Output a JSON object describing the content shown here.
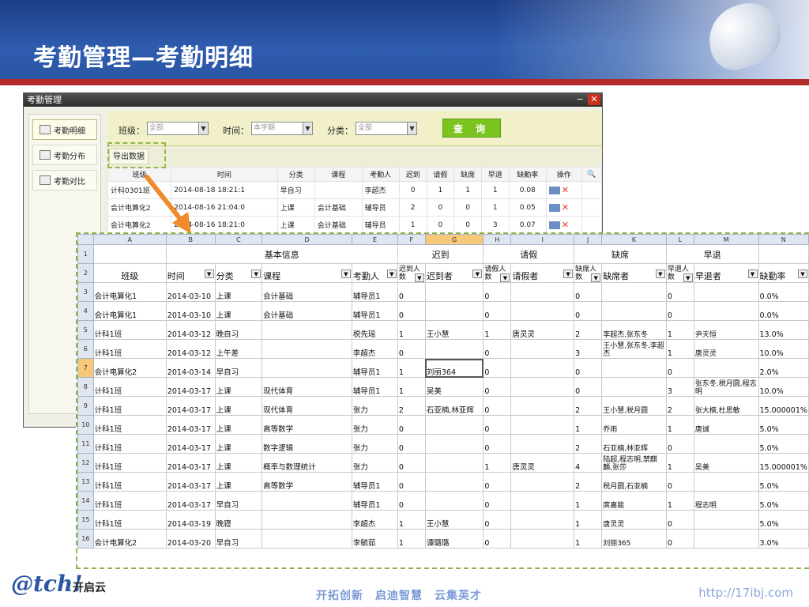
{
  "slide": {
    "title": "考勤管理—考勤明细"
  },
  "window": {
    "title": "考勤管理",
    "min": "−",
    "close": "✕",
    "sidebar": [
      "考勤明细",
      "考勤分布",
      "考勤对比"
    ],
    "filters": {
      "class_label": "班级：",
      "class_value": "全部",
      "time_label": "时间：",
      "time_value": "本学期",
      "type_label": "分类：",
      "type_value": "全部",
      "query": "查 询"
    },
    "export": "导出数据",
    "grid": {
      "headers": [
        "班级",
        "时间",
        "分类",
        "课程",
        "考勤人",
        "迟到",
        "请假",
        "缺席",
        "早退",
        "缺勤率",
        "操作"
      ],
      "rows": [
        [
          "计科0301班",
          "2014-08-18 18:21:1",
          "早自习",
          "",
          "李超杰",
          "0",
          "1",
          "1",
          "1",
          "0.08"
        ],
        [
          "会计电算化2",
          "2014-08-16 21:04:0",
          "上课",
          "会计基础",
          "辅导员",
          "2",
          "0",
          "0",
          "1",
          "0.05"
        ],
        [
          "会计电算化2",
          "2014-08-16 18:21:0",
          "上课",
          "会计基础",
          "辅导员",
          "1",
          "0",
          "0",
          "3",
          "0.07"
        ]
      ]
    }
  },
  "sheet": {
    "columns": [
      "A",
      "B",
      "C",
      "D",
      "E",
      "F",
      "G",
      "H",
      "I",
      "J",
      "K",
      "L",
      "M",
      "N"
    ],
    "groups": {
      "basic": "基本信息",
      "late": "迟到",
      "leave": "请假",
      "absent": "缺席",
      "early": "早退"
    },
    "headers": {
      "class": "班级",
      "time": "时间",
      "type": "分类",
      "course": "课程",
      "checker": "考勤人",
      "late_count": "迟到人数",
      "late_names": "迟到者",
      "leave_count": "请假人数",
      "leave_names": "请假者",
      "absent_count": "缺席人数",
      "absent_names": "缺席者",
      "early_count": "早退人数",
      "early_names": "早退者",
      "rate": "缺勤率"
    },
    "rows": [
      [
        "3",
        "会计电算化1",
        "2014-03-10",
        "上课",
        "会计基础",
        "辅导员1",
        "0",
        "",
        "0",
        "",
        "0",
        "",
        "0",
        "",
        "0.0%"
      ],
      [
        "4",
        "会计电算化1",
        "2014-03-10",
        "上课",
        "会计基础",
        "辅导员1",
        "0",
        "",
        "0",
        "",
        "0",
        "",
        "0",
        "",
        "0.0%"
      ],
      [
        "5",
        "计科1班",
        "2014-03-12",
        "晚自习",
        "",
        "税先瑶",
        "1",
        "王小慧",
        "1",
        "唐灵灵",
        "2",
        "李超杰,张东冬",
        "1",
        "尹天恒",
        "13.0%"
      ],
      [
        "6",
        "计科1班",
        "2014-03-12",
        "上午差",
        "",
        "李超杰",
        "0",
        "",
        "0",
        "",
        "3",
        "王小慧,张东冬,李超杰",
        "1",
        "唐灵灵",
        "10.0%"
      ],
      [
        "7",
        "会计电算化2",
        "2014-03-14",
        "早自习",
        "",
        "辅导员1",
        "1",
        "刘丽364",
        "0",
        "",
        "0",
        "",
        "0",
        "",
        "2.0%"
      ],
      [
        "8",
        "计科1班",
        "2014-03-17",
        "上课",
        "现代体育",
        "辅导员1",
        "1",
        "吴美",
        "0",
        "",
        "0",
        "",
        "3",
        "张东冬,税月圆,程志明",
        "10.0%"
      ],
      [
        "9",
        "计科1班",
        "2014-03-17",
        "上课",
        "现代体育",
        "张力",
        "2",
        "石亚楠,林亚辉",
        "0",
        "",
        "2",
        "王小慧,税月圆",
        "2",
        "张大楠,杜思敏",
        "15.000001%"
      ],
      [
        "10",
        "计科1班",
        "2014-03-17",
        "上课",
        "高等数学",
        "张力",
        "0",
        "",
        "0",
        "",
        "1",
        "乔雨",
        "1",
        "唐诚",
        "5.0%"
      ],
      [
        "11",
        "计科1班",
        "2014-03-17",
        "上课",
        "数字逻辑",
        "张力",
        "0",
        "",
        "0",
        "",
        "2",
        "石亚楠,林亚辉",
        "0",
        "",
        "5.0%"
      ],
      [
        "12",
        "计科1班",
        "2014-03-17",
        "上课",
        "概率与数理统计",
        "张力",
        "0",
        "",
        "1",
        "唐灵灵",
        "4",
        "陆超,程志明,禁麒麟,张莎",
        "1",
        "吴美",
        "15.000001%"
      ],
      [
        "13",
        "计科1班",
        "2014-03-17",
        "上课",
        "高等数学",
        "辅导员1",
        "0",
        "",
        "0",
        "",
        "2",
        "税月圆,石亚楠",
        "0",
        "",
        "5.0%"
      ],
      [
        "14",
        "计科1班",
        "2014-03-17",
        "早自习",
        "",
        "辅导员1",
        "0",
        "",
        "0",
        "",
        "1",
        "庹嘉能",
        "1",
        "程志明",
        "5.0%"
      ],
      [
        "15",
        "计科1班",
        "2014-03-19",
        "晚寝",
        "",
        "李超杰",
        "1",
        "王小慧",
        "0",
        "",
        "1",
        "唐灵灵",
        "0",
        "",
        "5.0%"
      ],
      [
        "16",
        "会计电算化2",
        "2014-03-20",
        "早自习",
        "",
        "李毓茹",
        "1",
        "谭璐璐",
        "0",
        "",
        "1",
        "刘丽365",
        "0",
        "",
        "3.0%"
      ]
    ]
  },
  "footer": {
    "logo_text": "@tch!",
    "logo_cn": "开启云",
    "slogan": "开拓创新　启迪智慧　云集英才",
    "url": "http://17ibj.com"
  }
}
